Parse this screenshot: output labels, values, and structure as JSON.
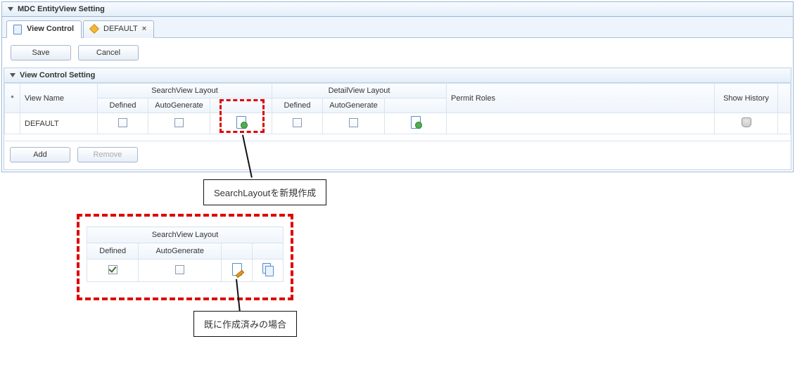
{
  "header": {
    "title": "MDC EntityView Setting"
  },
  "tabs": [
    {
      "label": "View Control",
      "icon": "page",
      "active": true,
      "closable": false
    },
    {
      "label": "DEFAULT",
      "icon": "cube",
      "active": false,
      "closable": true
    }
  ],
  "toolbar": {
    "save": "Save",
    "cancel": "Cancel"
  },
  "section": {
    "title": "View Control Setting",
    "columns": {
      "row_marker": "*",
      "view_name": "View Name",
      "searchview_layout": "SearchView Layout",
      "search_defined": "Defined",
      "search_autogen": "AutoGenerate",
      "detailview_layout": "DetailView Layout",
      "detail_defined": "Defined",
      "detail_autogen": "AutoGenerate",
      "permit_roles": "Permit Roles",
      "show_history": "Show History"
    },
    "rows": [
      {
        "view_name": "DEFAULT",
        "search_defined": false,
        "search_autogen": false,
        "search_action_icon": "doc-new",
        "detail_defined": false,
        "detail_autogen": false,
        "detail_action_icon": "doc-new",
        "permit_roles": "",
        "show_history_icon": "database"
      }
    ],
    "buttons": {
      "add": "Add",
      "remove": "Remove"
    }
  },
  "annotations": {
    "callout1": "SearchLayoutを新規作成",
    "callout2": "既に作成済みの場合"
  },
  "inset": {
    "header": "SearchView Layout",
    "defined_label": "Defined",
    "autogen_label": "AutoGenerate",
    "row": {
      "defined": true,
      "autogen": false,
      "edit_icon": "doc-edit",
      "copy_icon": "doc-copy"
    }
  }
}
